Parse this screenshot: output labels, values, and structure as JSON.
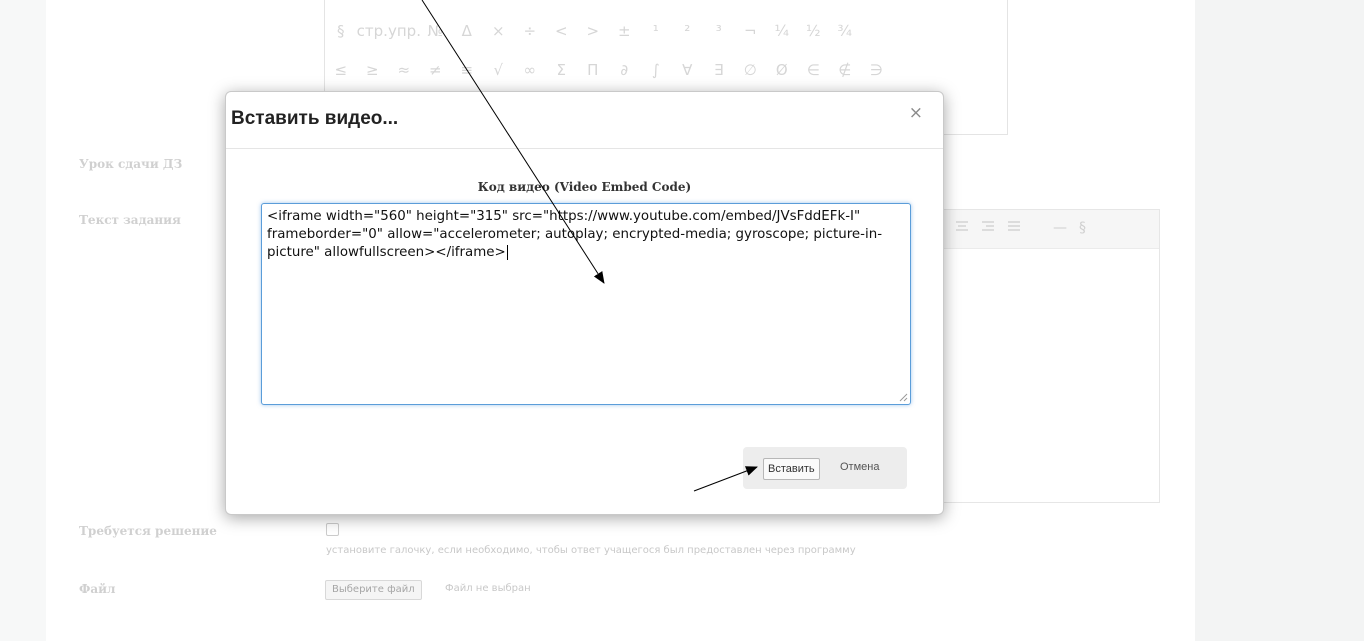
{
  "special_chars": {
    "row1": [
      "§",
      "стр.",
      "упр.",
      "№",
      "Δ",
      "×",
      "÷",
      "<",
      ">",
      "±",
      "¹",
      "²",
      "³",
      "¬",
      "¼",
      "½",
      "¾"
    ],
    "row2": [
      "≤",
      "≥",
      "≈",
      "≠",
      "≡",
      "√",
      "∞",
      "Σ",
      "Π",
      "∂",
      "∫",
      "∀",
      "∃",
      "∅",
      "Ø",
      "∈",
      "∉",
      "∋"
    ]
  },
  "form": {
    "lesson_label": "Урок сдачи ДЗ",
    "task_text_label": "Текст задания",
    "solution_required_label": "Требуется решение",
    "solution_hint": "установите галочку, если необходимо, чтобы ответ учащегося был предоставлен через программу",
    "file_label": "Файл",
    "file_button": "Выберите файл",
    "file_status": "Файл не выбран",
    "toolbar_icons": [
      "align-center-icon",
      "align-right-icon",
      "align-justify-icon",
      "horizontal-rule-icon",
      "section-sign-icon"
    ],
    "toolbar_glyphs": {
      "rule": "—",
      "section": "§"
    }
  },
  "dialog": {
    "title": "Вставить видео...",
    "close_glyph": "×",
    "code_label": "Код видео (Video Embed Code)",
    "code_value": "<iframe width=\"560\" height=\"315\" src=\"https://www.youtube.com/embed/JVsFddEFk-I\" frameborder=\"0\" allow=\"accelerometer; autoplay; encrypted-media; gyroscope; picture-in-picture\" allowfullscreen></iframe>",
    "insert_button": "Вставить",
    "cancel_button": "Отмена"
  },
  "colors": {
    "focus_border": "#5b9dd9",
    "label_gray": "#d0d0d0",
    "annotation_arrow": "#000000"
  }
}
